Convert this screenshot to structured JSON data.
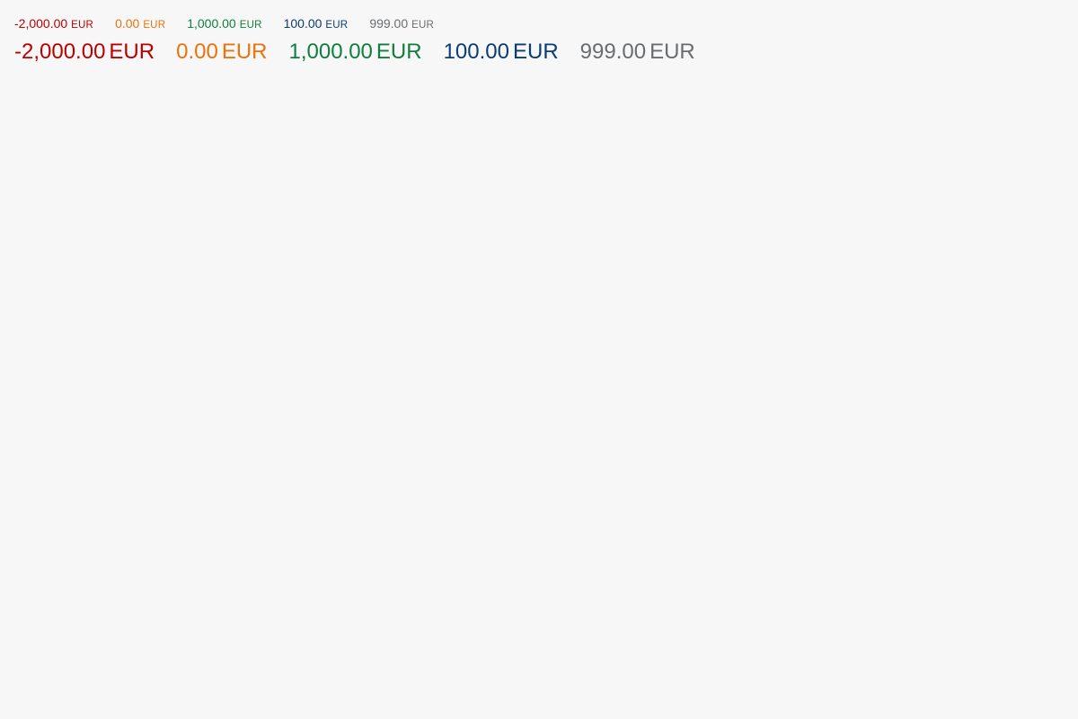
{
  "colors": {
    "negative": "#bb0000",
    "critical": "#e9730c",
    "positive": "#107e3e",
    "information": "#0a3d73",
    "neutral": "#6a6d70"
  },
  "small_row": [
    {
      "value": "-2,000.00",
      "unit": "EUR",
      "state": "negative"
    },
    {
      "value": "0.00",
      "unit": "EUR",
      "state": "critical"
    },
    {
      "value": "1,000.00",
      "unit": "EUR",
      "state": "positive"
    },
    {
      "value": "100.00",
      "unit": "EUR",
      "state": "information"
    },
    {
      "value": "999.00",
      "unit": "EUR",
      "state": "neutral"
    }
  ],
  "large_row": [
    {
      "value": "-2,000.00",
      "unit": "EUR",
      "state": "negative"
    },
    {
      "value": "0.00",
      "unit": "EUR",
      "state": "critical"
    },
    {
      "value": "1,000.00",
      "unit": "EUR",
      "state": "positive"
    },
    {
      "value": "100.00",
      "unit": "EUR",
      "state": "information"
    },
    {
      "value": "999.00",
      "unit": "EUR",
      "state": "neutral"
    }
  ]
}
